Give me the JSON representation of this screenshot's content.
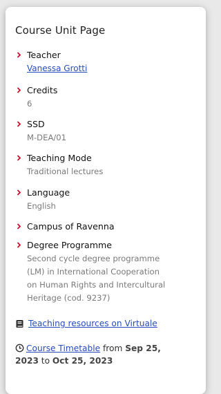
{
  "panel": {
    "title": "Course Unit Page"
  },
  "details": {
    "teacher": {
      "label": "Teacher",
      "value": "Vanessa Grotti"
    },
    "credits": {
      "label": "Credits",
      "value": "6"
    },
    "ssd": {
      "label": "SSD",
      "value": "M-DEA/01"
    },
    "teaching_mode": {
      "label": "Teaching Mode",
      "value": "Traditional lectures"
    },
    "language": {
      "label": "Language",
      "value": "English"
    },
    "campus": {
      "label": "Campus of Ravenna"
    },
    "degree_programme": {
      "label": "Degree Programme",
      "value_lines": [
        "Second cycle degree programme",
        "(LM) in International Cooperation",
        "on Human Rights and Intercultural",
        "Heritage (cod. 9237)"
      ]
    }
  },
  "resources": {
    "virtuale_link": "Teaching resources on Virtuale"
  },
  "timetable": {
    "link": "Course Timetable",
    "from_word": "from",
    "start": "Sep 25,",
    "start_year": "2023",
    "to_word": "to",
    "end": "Oct 25, 2023"
  },
  "colors": {
    "accent_chevron": "#c8102e",
    "link": "#2a4bbd",
    "muted_text": "#7a7a7a"
  },
  "icons": {
    "bullet": "chevron-right-icon",
    "resources": "book-icon",
    "timetable": "clock-icon"
  }
}
